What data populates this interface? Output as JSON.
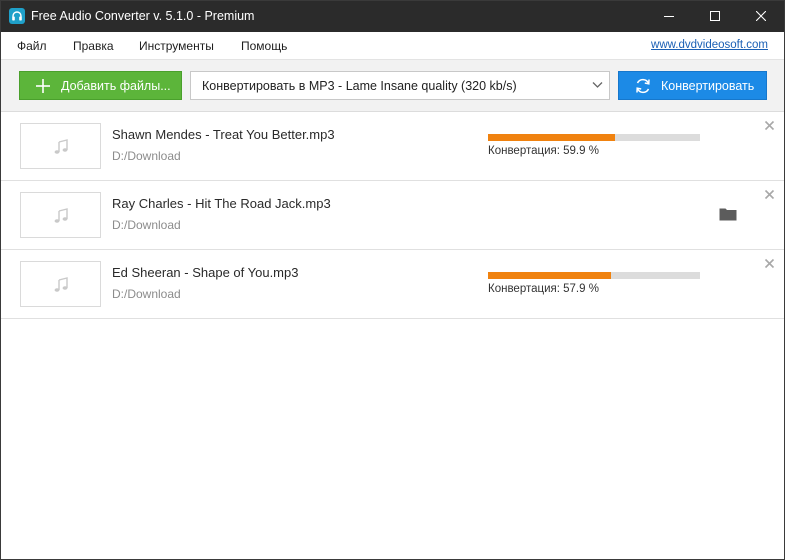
{
  "window": {
    "title": "Free Audio Converter v. 5.1.0 - Premium",
    "icons": {
      "app": "headphones-icon",
      "minimize": "minimize-icon",
      "maximize": "maximize-icon",
      "close": "close-icon"
    }
  },
  "menu": {
    "items": [
      {
        "label": "Файл"
      },
      {
        "label": "Правка"
      },
      {
        "label": "Инструменты"
      },
      {
        "label": "Помощь"
      }
    ],
    "site_link": "www.dvdvideosoft.com"
  },
  "toolbar": {
    "add_files_label": "Добавить файлы...",
    "format_selected": "Конвертировать в MP3 - Lame Insane quality (320 kb/s)",
    "convert_label": "Конвертировать",
    "colors": {
      "add": "#5cb53a",
      "convert": "#1c8ae6"
    }
  },
  "files": [
    {
      "name": "Shawn Mendes - Treat You Better.mp3",
      "path": "D:/Download",
      "status": "Конвертация: 59.9 %",
      "progress": 0.599,
      "state": "converting"
    },
    {
      "name": "Ray Charles - Hit The Road Jack.mp3",
      "path": "D:/Download",
      "status": "",
      "progress": 1.0,
      "state": "done"
    },
    {
      "name": "Ed Sheeran - Shape of You.mp3",
      "path": "D:/Download",
      "status": "Конвертация: 57.9 %",
      "progress": 0.579,
      "state": "converting"
    }
  ],
  "colors": {
    "progress": "#f0820f",
    "titlebar": "#2b2b2b"
  }
}
